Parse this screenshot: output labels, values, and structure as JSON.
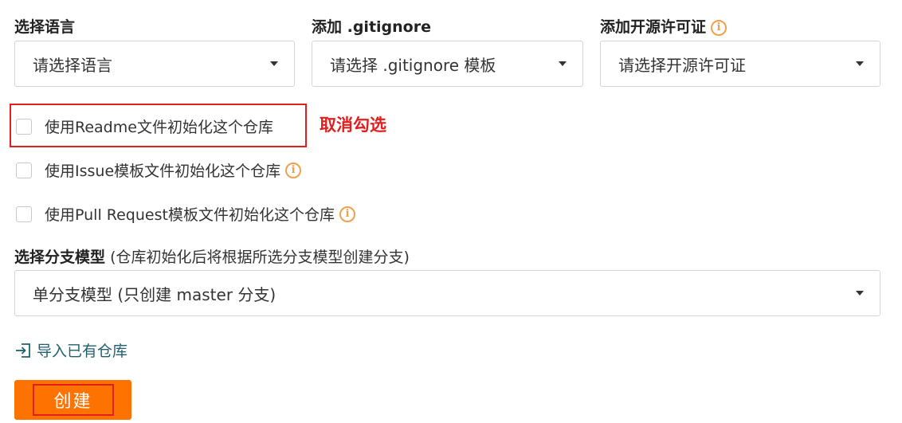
{
  "language": {
    "label": "选择语言",
    "value": "请选择语言"
  },
  "gitignore": {
    "label": "添加 .gitignore",
    "value": "请选择 .gitignore 模板"
  },
  "license": {
    "label": "添加开源许可证",
    "value": "请选择开源许可证",
    "info_icon": "info-icon"
  },
  "checkboxes": [
    {
      "label": "使用Readme文件初始化这个仓库",
      "checked": false
    },
    {
      "label": "使用Issue模板文件初始化这个仓库",
      "checked": false
    },
    {
      "label": "使用Pull Request模板文件初始化这个仓库",
      "checked": false
    }
  ],
  "annotation": {
    "text": "取消勾选",
    "color": "#e02020"
  },
  "branch": {
    "label": "选择分支模型",
    "hint": "(仓库初始化后将根据所选分支模型创建分支)",
    "value": "单分支模型 (只创建 master 分支)"
  },
  "import_link": {
    "label": "导入已有仓库",
    "icon": "import-icon"
  },
  "create_button": {
    "label": "创建",
    "color": "#fe7300"
  },
  "colors": {
    "accent": "#fe7300",
    "info": "#f0a14a",
    "link": "#20606e",
    "annotation": "#e02020"
  }
}
